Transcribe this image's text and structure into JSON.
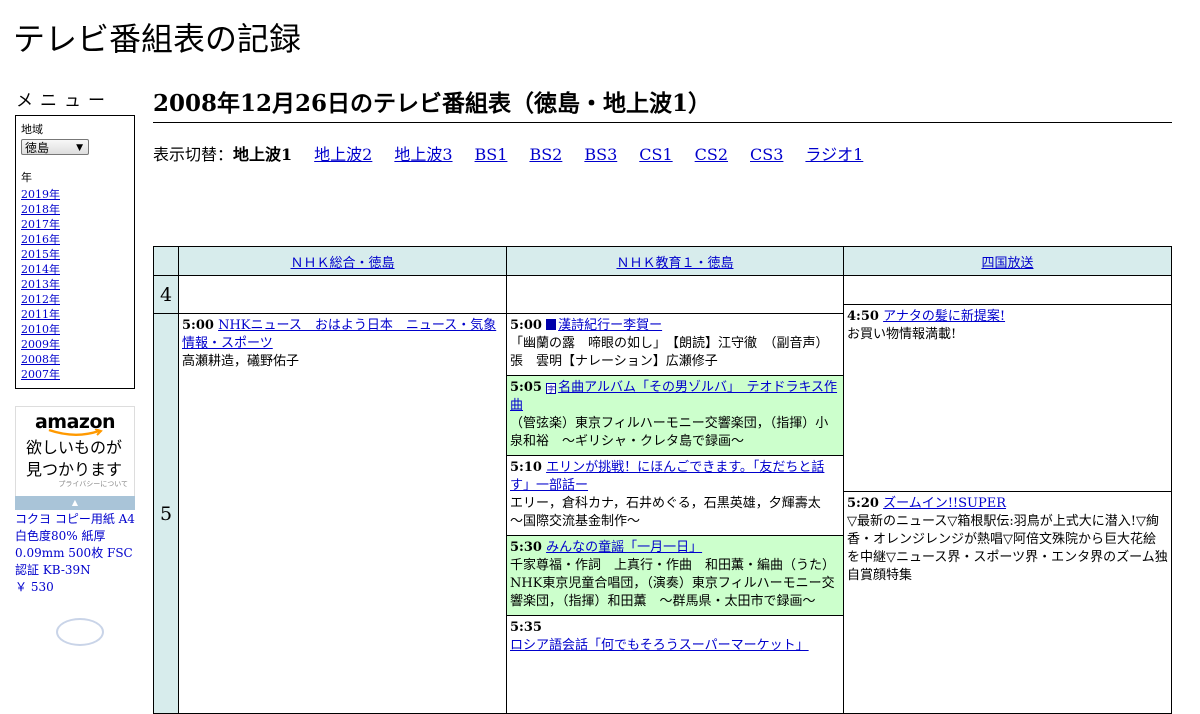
{
  "site": {
    "title": "テレビ番組表の記録"
  },
  "sidebar": {
    "menu_title": "メニュー",
    "region_label": "地域",
    "region_value": "徳島",
    "year_label": "年",
    "years": [
      "2019年",
      "2018年",
      "2017年",
      "2016年",
      "2015年",
      "2014年",
      "2013年",
      "2012年",
      "2011年",
      "2010年",
      "2009年",
      "2008年",
      "2007年"
    ]
  },
  "ad": {
    "brand": "amazon",
    "tagline_1": "欲しいものが",
    "tagline_2": "見つかります",
    "privacy": "プライバシーについて",
    "product_title": "コクヨ コピー用紙 A4 白色度80% 紙厚 0.09mm 500枚 FSC認証 KB-39N",
    "price": "￥ 530"
  },
  "main": {
    "heading": "2008年12月26日のテレビ番組表（徳島・地上波1）",
    "switch_label": "表示切替：",
    "current": "地上波1",
    "links": [
      "地上波2",
      "地上波3",
      "BS1",
      "BS2",
      "BS3",
      "CS1",
      "CS2",
      "CS3",
      "ラジオ1"
    ]
  },
  "schedule": {
    "channels": [
      "ＮＨＫ総合・徳島",
      "ＮＨＫ教育１・徳島",
      "四国放送"
    ],
    "hours": [
      "4",
      "5"
    ],
    "ch1": [
      {
        "time": "5:00",
        "title": "NHKニュース　おはよう日本　ニュース・気象情報・スポーツ",
        "desc": "高瀬耕造，礒野佑子"
      }
    ],
    "ch2": [
      {
        "time": "5:00",
        "icon": "data-broadcast-icon",
        "title": "漢詩紀行ー李賀ー",
        "desc": "「幽蘭の露　啼眼の如し」　【朗読】江守徹　（副音声）張　雲明【ナレーション】広瀬修子",
        "highlight": false
      },
      {
        "time": "5:05",
        "icon": "bilingual-icon",
        "icon_text": "字",
        "title": "名曲アルバム「その男ゾルバ」　テオドラキス作曲",
        "desc": "（管弦楽）東京フィルハーモニー交響楽団，（指揮）小泉和裕　～ギリシャ・クレタ島で録画～",
        "highlight": true
      },
      {
        "time": "5:10",
        "title": "エリンが挑戦！にほんごできます。「友だちと話す」一部話ー",
        "desc": "エリー，倉科カナ，石井めぐる，石黒英雄，夕輝壽太　～国際交流基金制作～",
        "highlight": false
      },
      {
        "time": "5:30",
        "title": "みんなの童謡「一月一日」",
        "desc": "千家尊福・作詞　上真行・作曲　和田薫・編曲（うた）NHK東京児童合唱団，（演奏）東京フィルハーモニー交響楽団，（指揮）和田薫　～群馬県・太田市で録画～",
        "highlight": true
      },
      {
        "time": "5:35",
        "title": "ロシア語会話「何でもそろうスーパーマーケット」",
        "desc": "",
        "highlight": false
      }
    ],
    "ch3": [
      {
        "time": "4:50",
        "title": "アナタの髪に新提案!",
        "desc": "お買い物情報満載!"
      },
      {
        "time": "5:20",
        "title": "ズームイン!!SUPER",
        "desc": "▽最新のニュース▽箱根駅伝:羽鳥が上式大に潜入!▽絢香・オレンジレンジが熱唱▽阿倍文殊院から巨大花絵を中継▽ニュース界・スポーツ界・エンタ界のズーム独自賞顔特集"
      }
    ]
  }
}
